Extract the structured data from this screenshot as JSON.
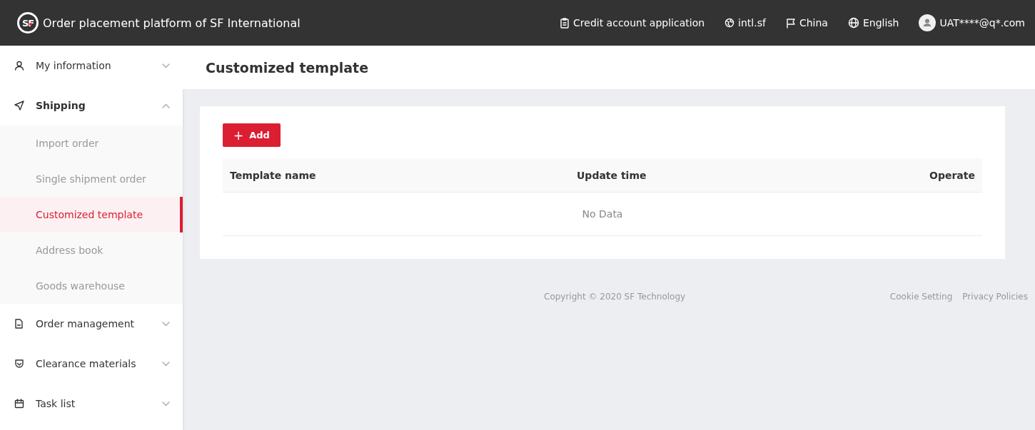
{
  "header": {
    "logo": "SF",
    "title": "Order placement platform of SF International",
    "links": [
      {
        "kind": "clipboard",
        "label": "Credit account application"
      },
      {
        "kind": "globe-pin",
        "label": "intl.sf"
      },
      {
        "kind": "flag",
        "label": "China"
      },
      {
        "kind": "globe",
        "label": "English"
      },
      {
        "kind": "avatar",
        "label": "UAT****@q*.com"
      }
    ]
  },
  "sidebar": {
    "items": [
      {
        "kind": "user",
        "label": "My information",
        "expanded": false
      },
      {
        "kind": "send",
        "label": "Shipping",
        "expanded": true,
        "children": [
          {
            "label": "Import order",
            "selected": false
          },
          {
            "label": "Single shipment order",
            "selected": false
          },
          {
            "label": "Customized template",
            "selected": true
          },
          {
            "label": "Address book",
            "selected": false
          },
          {
            "label": "Goods warehouse",
            "selected": false
          }
        ]
      },
      {
        "kind": "doc",
        "label": "Order management",
        "expanded": false
      },
      {
        "kind": "shield",
        "label": "Clearance materials",
        "expanded": false
      },
      {
        "kind": "calendar",
        "label": "Task list",
        "expanded": false
      }
    ]
  },
  "page_title": "Customized template",
  "add_button": {
    "icon": "+",
    "label": "Add"
  },
  "table": {
    "columns": [
      "Template name",
      "Update time",
      "Operate"
    ],
    "empty_text": "No Data"
  },
  "footer": {
    "copyright": "Copyright © 2020 SF Technology",
    "links": [
      "Cookie Setting",
      "Privacy Policies"
    ]
  }
}
